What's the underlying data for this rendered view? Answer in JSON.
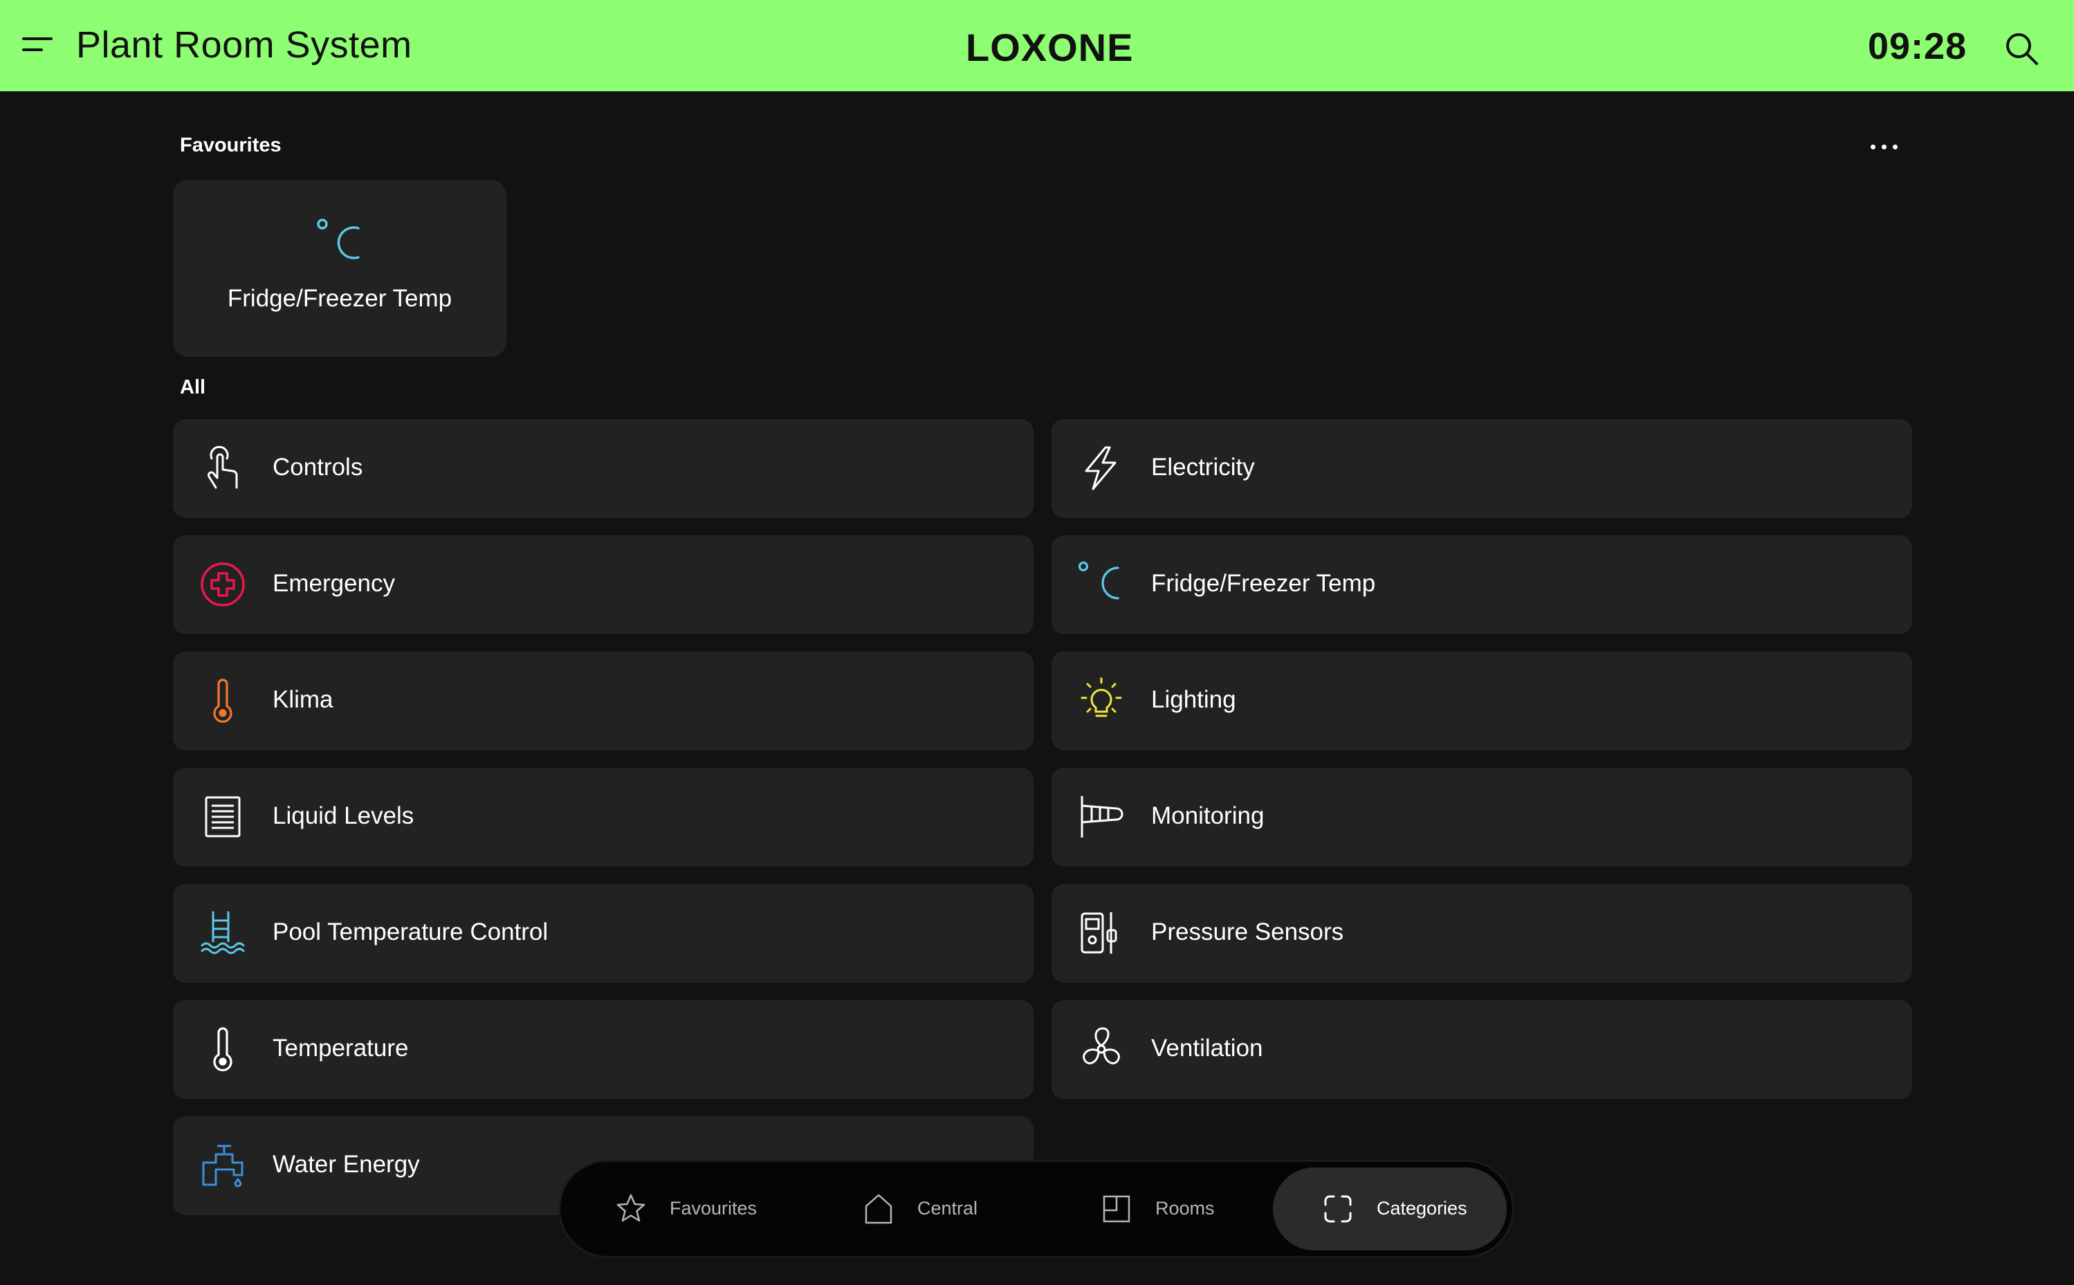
{
  "header": {
    "title": "Plant Room System",
    "brand": "LOXONE",
    "time": "09:28",
    "background_color": "#8dfd71"
  },
  "favourites": {
    "heading": "Favourites",
    "items": [
      {
        "label": "Fridge/Freezer Temp",
        "icon": "celsius-icon",
        "color": "#5bc8e6"
      }
    ]
  },
  "all": {
    "heading": "All",
    "items": [
      {
        "label": "Controls",
        "icon": "touch-hand-icon",
        "color": "#ffffff"
      },
      {
        "label": "Electricity",
        "icon": "lightning-bolt-icon",
        "color": "#ffffff"
      },
      {
        "label": "Emergency",
        "icon": "medical-cross-icon",
        "color": "#e8194a"
      },
      {
        "label": "Fridge/Freezer Temp",
        "icon": "celsius-icon",
        "color": "#5bc8e6"
      },
      {
        "label": "Klima",
        "icon": "thermometer-icon",
        "color": "#f07a2a"
      },
      {
        "label": "Lighting",
        "icon": "light-bulb-icon",
        "color": "#f2e63a"
      },
      {
        "label": "Liquid Levels",
        "icon": "document-lines-icon",
        "color": "#ffffff"
      },
      {
        "label": "Monitoring",
        "icon": "windsock-icon",
        "color": "#ffffff"
      },
      {
        "label": "Pool Temperature Control",
        "icon": "pool-ladder-icon",
        "color": "#5bc8e6"
      },
      {
        "label": "Pressure Sensors",
        "icon": "pressure-sensor-icon",
        "color": "#ffffff"
      },
      {
        "label": "Temperature",
        "icon": "thermometer-icon",
        "color": "#ffffff"
      },
      {
        "label": "Ventilation",
        "icon": "fan-icon",
        "color": "#ffffff"
      },
      {
        "label": "Water Energy",
        "icon": "water-tap-icon",
        "color": "#3b8fe0"
      }
    ]
  },
  "tabbar": {
    "tabs": [
      {
        "label": "Favourites",
        "icon": "star-icon"
      },
      {
        "label": "Central",
        "icon": "house-icon"
      },
      {
        "label": "Rooms",
        "icon": "room-icon"
      },
      {
        "label": "Categories",
        "icon": "categories-icon",
        "active": true
      }
    ]
  }
}
